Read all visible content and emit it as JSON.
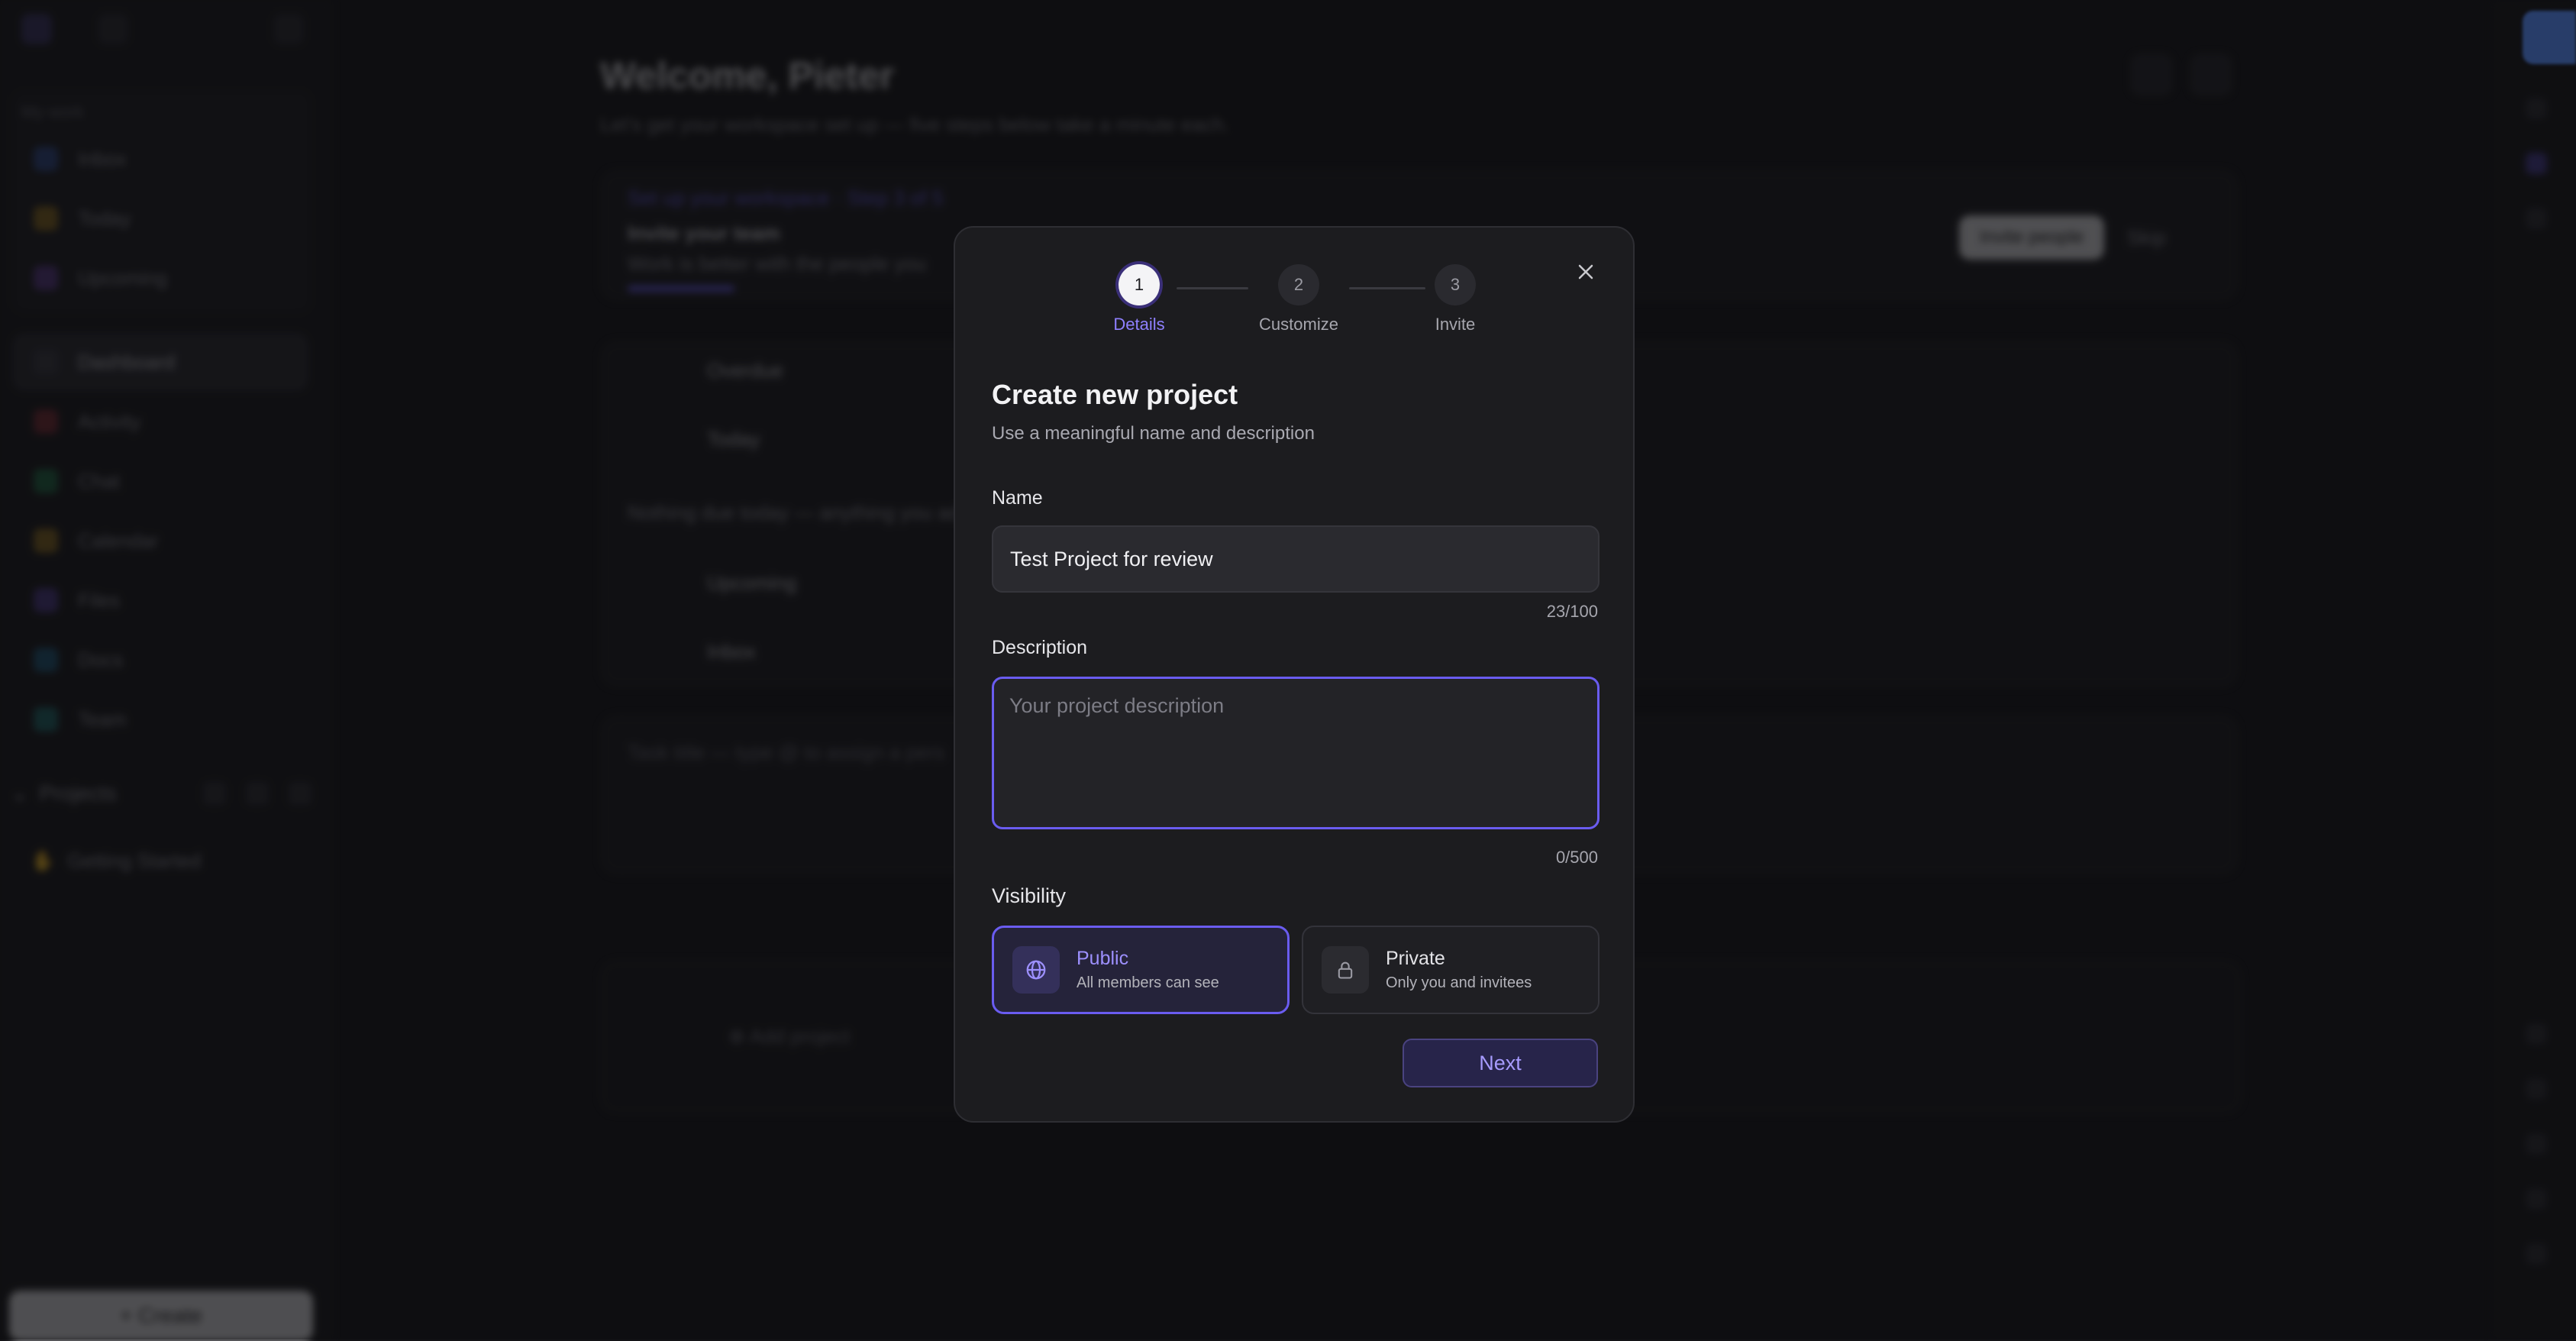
{
  "background": {
    "title": "Welcome, Pieter",
    "subtitle": "Let's get your workspace set up — five steps below take a minute each.",
    "setup": {
      "link": "Set up your workspace",
      "step_text": "Step 3 of 5",
      "heading": "Invite your team",
      "body": "Work is better with the people you",
      "invite_button": "Invite people",
      "skip_button": "Skip"
    },
    "sections": [
      "Overdue",
      "Today",
      "Upcoming",
      "Inbox"
    ],
    "today_empty": "Nothing due today — anything you ad",
    "task_placeholder": "Task title — type @ to assign a pers",
    "add_project": "Add project",
    "sidebar": {
      "group_label": "My work",
      "group_items": [
        "Inbox",
        "Today",
        "Upcoming"
      ],
      "nav_items": [
        "Dashboard",
        "Activity",
        "Chat",
        "Calendar",
        "Files",
        "Docs",
        "Team"
      ],
      "projects_label": "Projects",
      "project": "Getting Started",
      "create": "Create"
    }
  },
  "modal": {
    "steps": [
      {
        "number": "1",
        "label": "Details"
      },
      {
        "number": "2",
        "label": "Customize"
      },
      {
        "number": "3",
        "label": "Invite"
      }
    ],
    "close_icon": "close-icon",
    "title": "Create new project",
    "subtitle": "Use a meaningful name and description",
    "name": {
      "label": "Name",
      "value": "Test Project for review",
      "counter": "23/100"
    },
    "description": {
      "label": "Description",
      "placeholder": "Your project description",
      "counter": "0/500"
    },
    "visibility": {
      "label": "Visibility",
      "options": [
        {
          "title": "Public",
          "desc": "All members can see",
          "icon": "globe-icon",
          "selected": true
        },
        {
          "title": "Private",
          "desc": "Only you and invitees",
          "icon": "lock-icon",
          "selected": false
        }
      ]
    },
    "next_label": "Next"
  },
  "colors": {
    "accent": "#6a5cf0",
    "accent_text": "#9d90ff",
    "modal_bg": "#1c1c1f",
    "page_bg": "#131316"
  }
}
